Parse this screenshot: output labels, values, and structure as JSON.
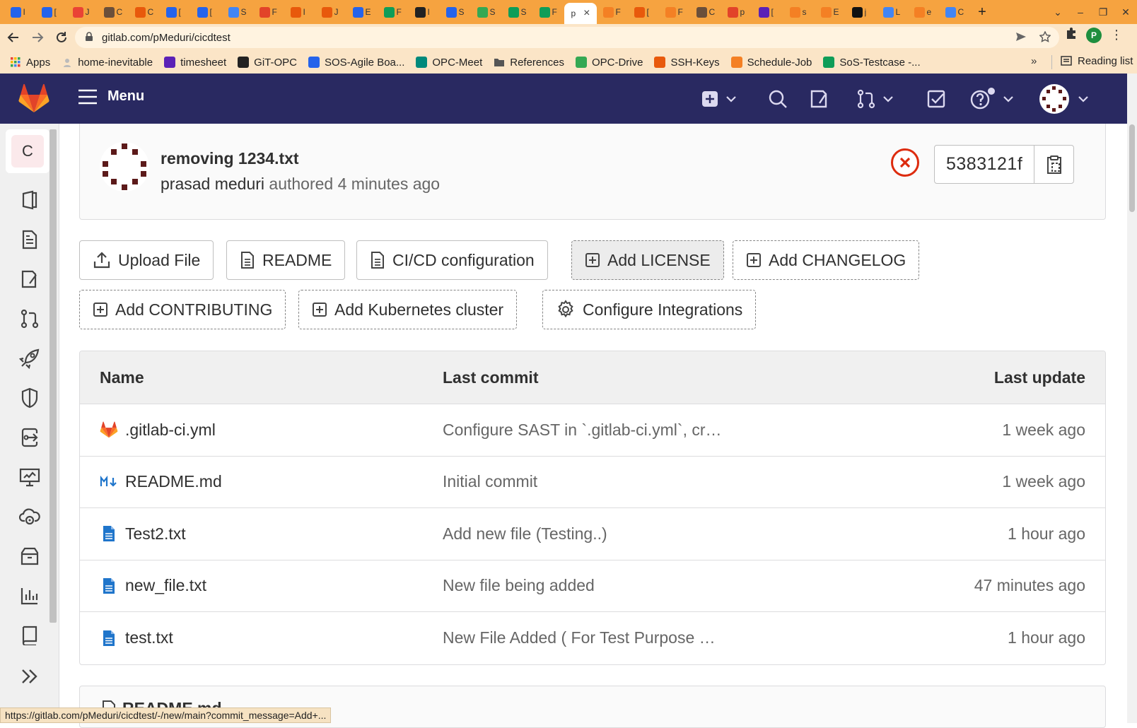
{
  "browser": {
    "tabs": [
      {
        "letter": "I",
        "color": "#2563eb"
      },
      {
        "letter": "[",
        "color": "#2563eb"
      },
      {
        "letter": "J",
        "color": "#ea4335"
      },
      {
        "letter": "C",
        "color": "#6b4f3a"
      },
      {
        "letter": "C",
        "color": "#e8590c"
      },
      {
        "letter": "[",
        "color": "#2563eb"
      },
      {
        "letter": "[",
        "color": "#2563eb"
      },
      {
        "letter": "S",
        "color": "#4285f4"
      },
      {
        "letter": "F",
        "color": "#e24329"
      },
      {
        "letter": "I",
        "color": "#e8590c"
      },
      {
        "letter": "J",
        "color": "#e8590c"
      },
      {
        "letter": "E",
        "color": "#2563eb"
      },
      {
        "letter": "F",
        "color": "#0f9d58"
      },
      {
        "letter": "I",
        "color": "#222222"
      },
      {
        "letter": "S",
        "color": "#2563eb"
      },
      {
        "letter": "S",
        "color": "#34a853"
      },
      {
        "letter": "S",
        "color": "#0f9d58"
      },
      {
        "letter": "F",
        "color": "#0f9d58"
      },
      {
        "letter": "p",
        "color": "#ffffff"
      },
      {
        "letter": "F",
        "color": "#f48024"
      },
      {
        "letter": "[",
        "color": "#e8590c"
      },
      {
        "letter": "F",
        "color": "#f48024"
      },
      {
        "letter": "C",
        "color": "#6b4f3a"
      },
      {
        "letter": "p",
        "color": "#e24329"
      },
      {
        "letter": "[",
        "color": "#5b21b6"
      },
      {
        "letter": "s",
        "color": "#f48024"
      },
      {
        "letter": "E",
        "color": "#f48024"
      },
      {
        "letter": "j",
        "color": "#111111"
      },
      {
        "letter": "L",
        "color": "#4285f4"
      },
      {
        "letter": "e",
        "color": "#f48024"
      },
      {
        "letter": "C",
        "color": "#4285f4"
      }
    ],
    "active_tab_index": 18,
    "active_tab_letter": "p",
    "close_glyph": "×",
    "new_tab": "+",
    "window_controls": [
      "⌄",
      "–",
      "❐",
      "✕"
    ],
    "url": "gitlab.com/pMeduri/cicdtest",
    "profile_letter": "P",
    "bookmarks": [
      {
        "label": "Apps",
        "icon": "apps-grid-icon",
        "color": "#ea4335"
      },
      {
        "label": "home-inevitable",
        "icon": "page-icon",
        "color": "#9e9e9e"
      },
      {
        "label": "timesheet",
        "icon": "timesheet-icon",
        "color": "#5b21b6"
      },
      {
        "label": "GiT-OPC",
        "icon": "github-icon",
        "color": "#222222"
      },
      {
        "label": "SOS-Agile Boa...",
        "icon": "jira-icon",
        "color": "#2563eb"
      },
      {
        "label": "OPC-Meet",
        "icon": "meet-icon",
        "color": "#00897b"
      },
      {
        "label": "References",
        "icon": "folder-icon",
        "color": "#555555"
      },
      {
        "label": "OPC-Drive",
        "icon": "drive-icon",
        "color": "#34a853"
      },
      {
        "label": "SSH-Keys",
        "icon": "gitlab-icon",
        "color": "#e8590c"
      },
      {
        "label": "Schedule-Job",
        "icon": "stackoverflow-icon",
        "color": "#f48024"
      },
      {
        "label": "SoS-Testcase -...",
        "icon": "sheets-icon",
        "color": "#0f9d58"
      }
    ],
    "bookmarks_more": "»",
    "reading_list": "Reading list",
    "status_url": "https://gitlab.com/pMeduri/cicdtest/-/new/main?commit_message=Add+..."
  },
  "gitlab": {
    "menu_label": "Menu",
    "project_letter": "C",
    "colors": {
      "topbar": "#292961",
      "fail": "#dd2b0e",
      "link_blue": "#1f75cb"
    }
  },
  "commit": {
    "title": "removing 1234.txt",
    "author": "prasad meduri",
    "authored_text": "authored 4 minutes ago",
    "sha": "5383121f"
  },
  "actions": [
    {
      "label": "Upload File",
      "icon": "upload-icon"
    },
    {
      "label": "README",
      "icon": "document-icon"
    },
    {
      "label": "CI/CD configuration",
      "icon": "document-icon"
    },
    {
      "label": "Add LICENSE",
      "icon": "plus-square-icon"
    },
    {
      "label": "Add CHANGELOG",
      "icon": "plus-square-icon"
    },
    {
      "label": "Add CONTRIBUTING",
      "icon": "plus-square-icon"
    },
    {
      "label": "Add Kubernetes cluster",
      "icon": "plus-square-icon"
    },
    {
      "label": "Configure Integrations",
      "icon": "settings-icon"
    }
  ],
  "files": {
    "headers": {
      "name": "Name",
      "last_commit": "Last commit",
      "last_update": "Last update"
    },
    "rows": [
      {
        "name": ".gitlab-ci.yml",
        "icon": "gitlab-icon",
        "commit": "Configure SAST in `.gitlab-ci.yml`, cr…",
        "updated": "1 week ago"
      },
      {
        "name": "README.md",
        "icon": "markdown-icon",
        "commit": "Initial commit",
        "updated": "1 week ago"
      },
      {
        "name": "Test2.txt",
        "icon": "file-icon",
        "commit": "Add new file (Testing..)",
        "updated": "1 hour ago"
      },
      {
        "name": "new_file.txt",
        "icon": "file-icon",
        "commit": "New file being added",
        "updated": "47 minutes ago"
      },
      {
        "name": "test.txt",
        "icon": "file-icon",
        "commit": "New File Added ( For Test Purpose …",
        "updated": "1 hour ago"
      }
    ]
  },
  "readme_heading": "README.md"
}
